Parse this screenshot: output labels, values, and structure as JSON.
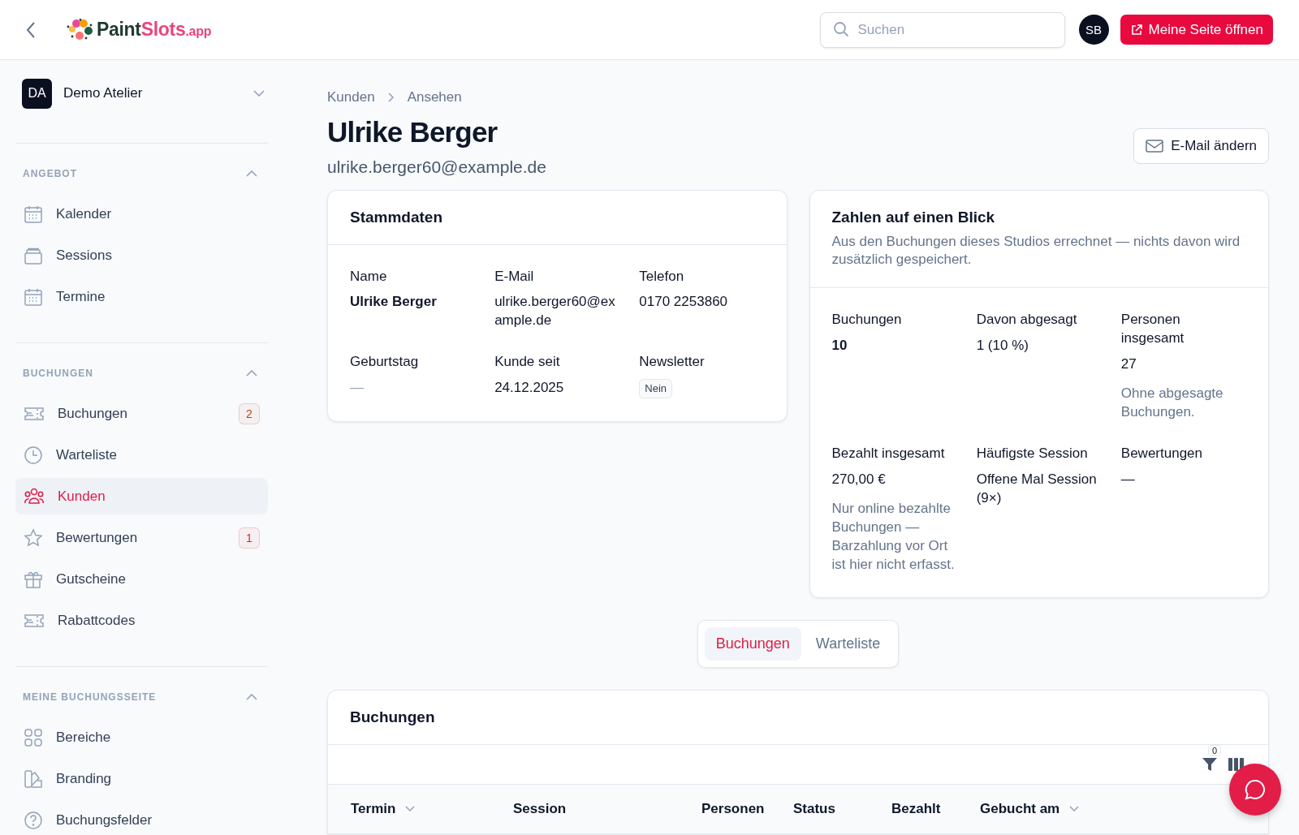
{
  "header": {
    "logo": [
      "Paint",
      "Slots",
      ".app"
    ],
    "search": {
      "placeholder": "Suchen"
    },
    "avatar": "SB",
    "open_button": "Meine Seite öffnen"
  },
  "sidebar": {
    "account": {
      "initials": "DA",
      "name": "Demo Atelier"
    },
    "sections": [
      {
        "title": "ANGEBOT",
        "expanded": true,
        "items": [
          {
            "label": "Kalender",
            "kind": "calendar",
            "selected": false
          },
          {
            "label": "Sessions",
            "kind": "stack",
            "selected": false
          },
          {
            "label": "Termine",
            "kind": "calendar",
            "selected": false
          }
        ]
      },
      {
        "title": "BUCHUNGEN",
        "expanded": true,
        "items": [
          {
            "label": "Buchungen",
            "kind": "ticket",
            "selected": false,
            "badge": "2",
            "color": "#c2410c"
          },
          {
            "label": "Warteliste",
            "kind": "clock",
            "selected": false
          },
          {
            "label": "Kunden",
            "kind": "people",
            "selected": true
          },
          {
            "label": "Bewertungen",
            "kind": "star",
            "selected": false,
            "badge": "1",
            "color": "#dc2626"
          },
          {
            "label": "Gutscheine",
            "kind": "gift",
            "selected": false
          },
          {
            "label": "Rabattcodes",
            "kind": "ticket",
            "selected": false
          }
        ]
      },
      {
        "title": "MEINE BUCHUNGSSEITE",
        "expanded": true,
        "items": [
          {
            "label": "Bereiche",
            "kind": "grid",
            "selected": false
          },
          {
            "label": "Branding",
            "kind": "swatch",
            "selected": false
          },
          {
            "label": "Buchungsfelder",
            "kind": "question",
            "selected": false
          }
        ]
      }
    ]
  },
  "breadcrumb": [
    "Kunden",
    "Ansehen"
  ],
  "title": "Ulrike Berger",
  "email": "ulrike.berger60@example.de",
  "email_button": "E-Mail ändern",
  "master_data": {
    "title": "Stammdaten",
    "fields": [
      {
        "label": "Name",
        "value": "Ulrike Berger",
        "kind": "strong"
      },
      {
        "label": "E-Mail",
        "value": "ulrike.berger60@example.de",
        "kind": "text"
      },
      {
        "label": "Telefon",
        "value": "0170 2253860",
        "kind": "text"
      },
      {
        "label": "Geburtstag",
        "value": "—",
        "kind": "muted"
      },
      {
        "label": "Kunde seit",
        "value": "24.12.2025",
        "kind": "text"
      },
      {
        "label": "Newsletter",
        "value": "Nein",
        "kind": "tag"
      }
    ]
  },
  "stats": {
    "title": "Zahlen auf einen Blick",
    "subtitle": "Aus den Buchungen dieses Studios errechnet — nichts davon wird zusätzlich gespeichert.",
    "items": [
      {
        "label": "Buchungen",
        "value": "10",
        "kind": "strong"
      },
      {
        "label": "Davon abgesagt",
        "value": "1 (10 %)",
        "kind": "text"
      },
      {
        "label": "Personen insgesamt",
        "value": "27",
        "kind": "text",
        "note": "Ohne abgesagte Buchungen."
      },
      {
        "label": "Bezahlt insgesamt",
        "value": "270,00 €",
        "kind": "text",
        "note": "Nur online bezahlte Buchungen — Barzahlung vor Ort ist hier nicht erfasst."
      },
      {
        "label": "Häufigste Session",
        "value": "Offene Mal Session (9×)",
        "kind": "text"
      },
      {
        "label": "Bewertungen",
        "value": "—",
        "kind": "text"
      }
    ]
  },
  "tabs": [
    {
      "label": "Buchungen",
      "selected": true
    },
    {
      "label": "Warteliste",
      "selected": false
    }
  ],
  "bookings": {
    "title": "Buchungen",
    "filter_count": "0",
    "columns": [
      {
        "label": "Termin",
        "sortable": true
      },
      {
        "label": "Session",
        "sortable": false
      },
      {
        "label": "Personen",
        "sortable": false
      },
      {
        "label": "Status",
        "sortable": false
      },
      {
        "label": "Bezahlt",
        "sortable": false
      },
      {
        "label": "Gebucht am",
        "sortable": true
      }
    ]
  }
}
